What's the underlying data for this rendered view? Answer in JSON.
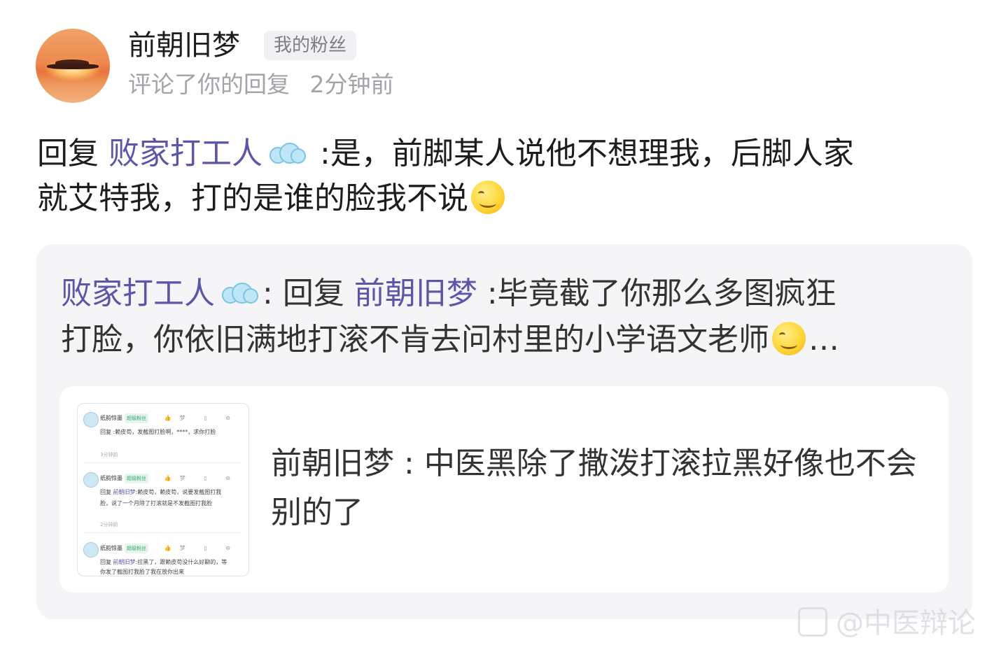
{
  "author": {
    "name": "前朝旧梦",
    "badge": "我的粉丝",
    "action": "评论了你的回复",
    "time": "2分钟前"
  },
  "comment": {
    "reply_prefix": "回复",
    "reply_to": "败家打工人",
    "text_line1": ":是，前脚某人说他不想理我，后脚人家",
    "text_line2": "就艾特我，打的是谁的脸我不说"
  },
  "quoted": {
    "author": "败家打工人",
    "separator": ":",
    "reply_prefix": "回复",
    "reply_to": "前朝旧梦",
    "text_line1": ":毕竟截了你那么多图疯狂",
    "text_line2": "打脸，你依旧满地打滚不肯去问村里的小学语文老师",
    "ellipsis": "…",
    "inner": {
      "author": "前朝旧梦",
      "separator": ":",
      "text": "中医黑除了撒泼打滚拉黑好像也不会别的了"
    },
    "thumbnail": {
      "rows": [
        {
          "name": "纸韵惊墨",
          "tag": "超级粉丝",
          "icons": "👍梦 ▯ ⊖",
          "line1": "回复 :赖皮苟，发截图打脸啊，****，求你打脸",
          "line2": "",
          "time": "3分钟前"
        },
        {
          "name": "纸韵惊墨",
          "tag": "超级粉丝",
          "icons": "👍梦 ▯ ⊖",
          "reply_prefix": "回复",
          "reply_to": "前朝旧梦",
          "line1": ":赖皮苟，赖皮苟，说要发截图打我",
          "line2": "脸，说了一个月除了打滚就是不发截图打我脸",
          "time": "2分钟前"
        },
        {
          "name": "纸韵惊墨",
          "tag": "超级粉丝",
          "icons": "👍梦 ▯ ⊖",
          "reply_prefix": "回复",
          "reply_to": "前朝旧梦",
          "line1": ":拉黑了，跟赖皮苟没什么好聊的，等",
          "line2": "你发了截图打我脸了我在放你出来"
        }
      ]
    }
  },
  "watermark": "@中医辩论"
}
